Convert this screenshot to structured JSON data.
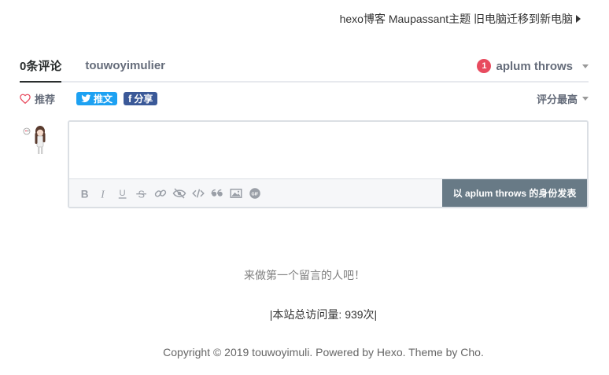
{
  "post_nav": {
    "next_title": "hexo博客 Maupassant主题 旧电脑迁移到新电脑"
  },
  "disqus": {
    "tabs": [
      {
        "label": "0条评论"
      },
      {
        "label": "touwoyimulier"
      }
    ],
    "user": {
      "notifications": "1",
      "name": "aplum throws"
    },
    "recommend_label": "推荐",
    "share": {
      "tweet_label": "推文",
      "facebook_label": "分享"
    },
    "sort_label": "评分最高",
    "post_button_label": "以 aplum throws 的身份发表",
    "toolbar_icons": [
      "bold-icon",
      "italic-icon",
      "underline-icon",
      "strikethrough-icon",
      "link-icon",
      "spoiler-icon",
      "code-icon",
      "quote-icon",
      "image-icon",
      "gif-icon"
    ],
    "empty_message": "来做第一个留言的人吧！"
  },
  "footer": {
    "visits": "|本站总访问量: 939次|",
    "copyright": "Copyright © 2019 touwoyimuli. Powered by Hexo. Theme by Cho."
  },
  "colors": {
    "post_button": "#687a86",
    "badge": "#e84b5f",
    "twitter": "#1da1f2",
    "facebook": "#3b5998"
  }
}
